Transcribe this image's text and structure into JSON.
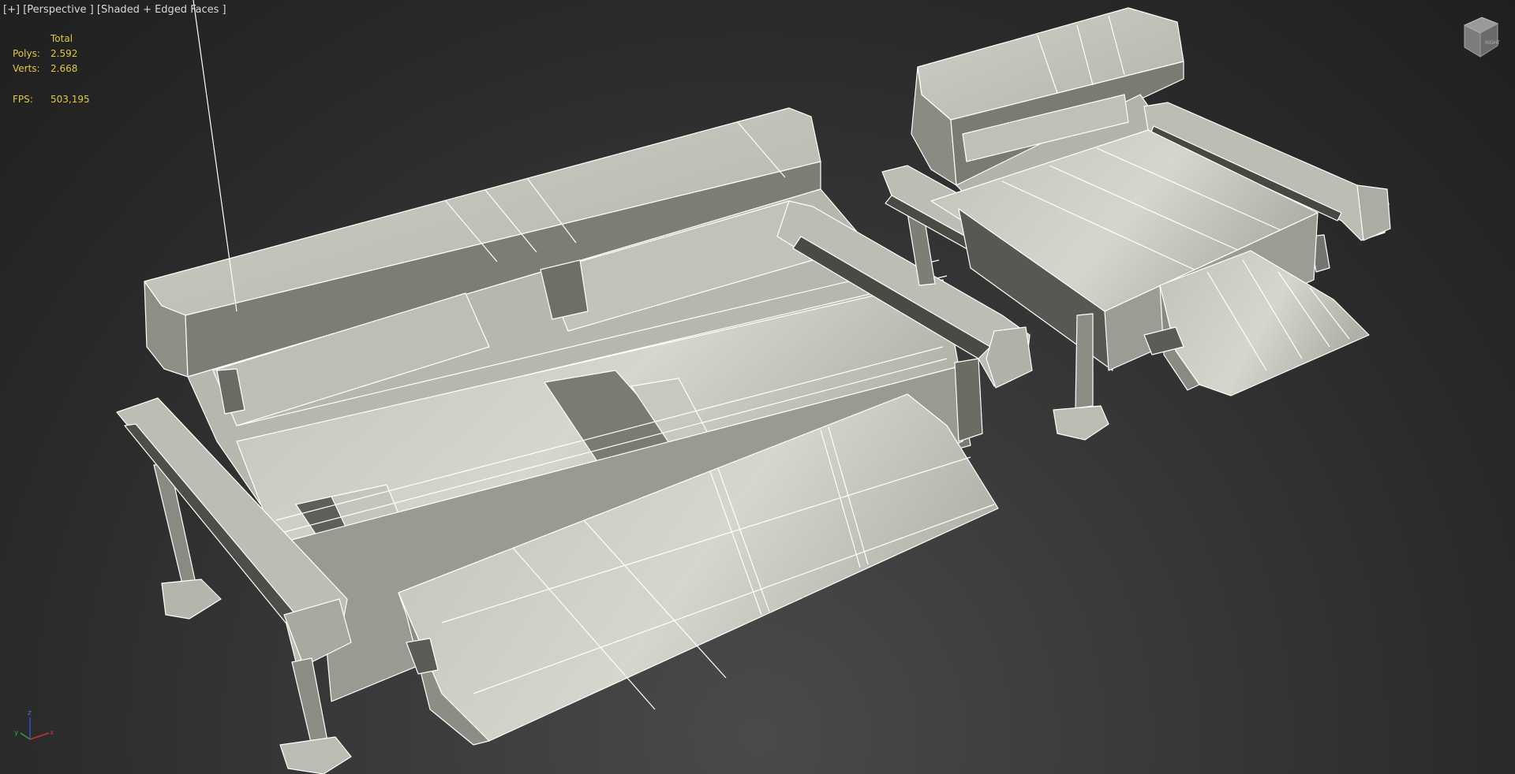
{
  "viewport": {
    "label_plus": "[+]",
    "label_view": "[Perspective ]",
    "label_shading": "[Shaded + Edged Faces ]"
  },
  "stats": {
    "header": "Total",
    "polys_label": "Polys:",
    "polys_value": "2.592",
    "verts_label": "Verts:",
    "verts_value": "2.668",
    "fps_label": "FPS:",
    "fps_value": "503,195"
  },
  "axis": {
    "x": "x",
    "y": "y",
    "z": "z"
  },
  "colors": {
    "stats_text": "#e0c848",
    "label_text": "#d8d8d8",
    "mesh_light": "#c9c9bf",
    "mesh_mid": "#a6a69c",
    "mesh_dark": "#5c5c56",
    "mesh_edge": "#ffffff"
  },
  "icons": [
    "viewcube-icon",
    "axis-tripod-icon"
  ]
}
